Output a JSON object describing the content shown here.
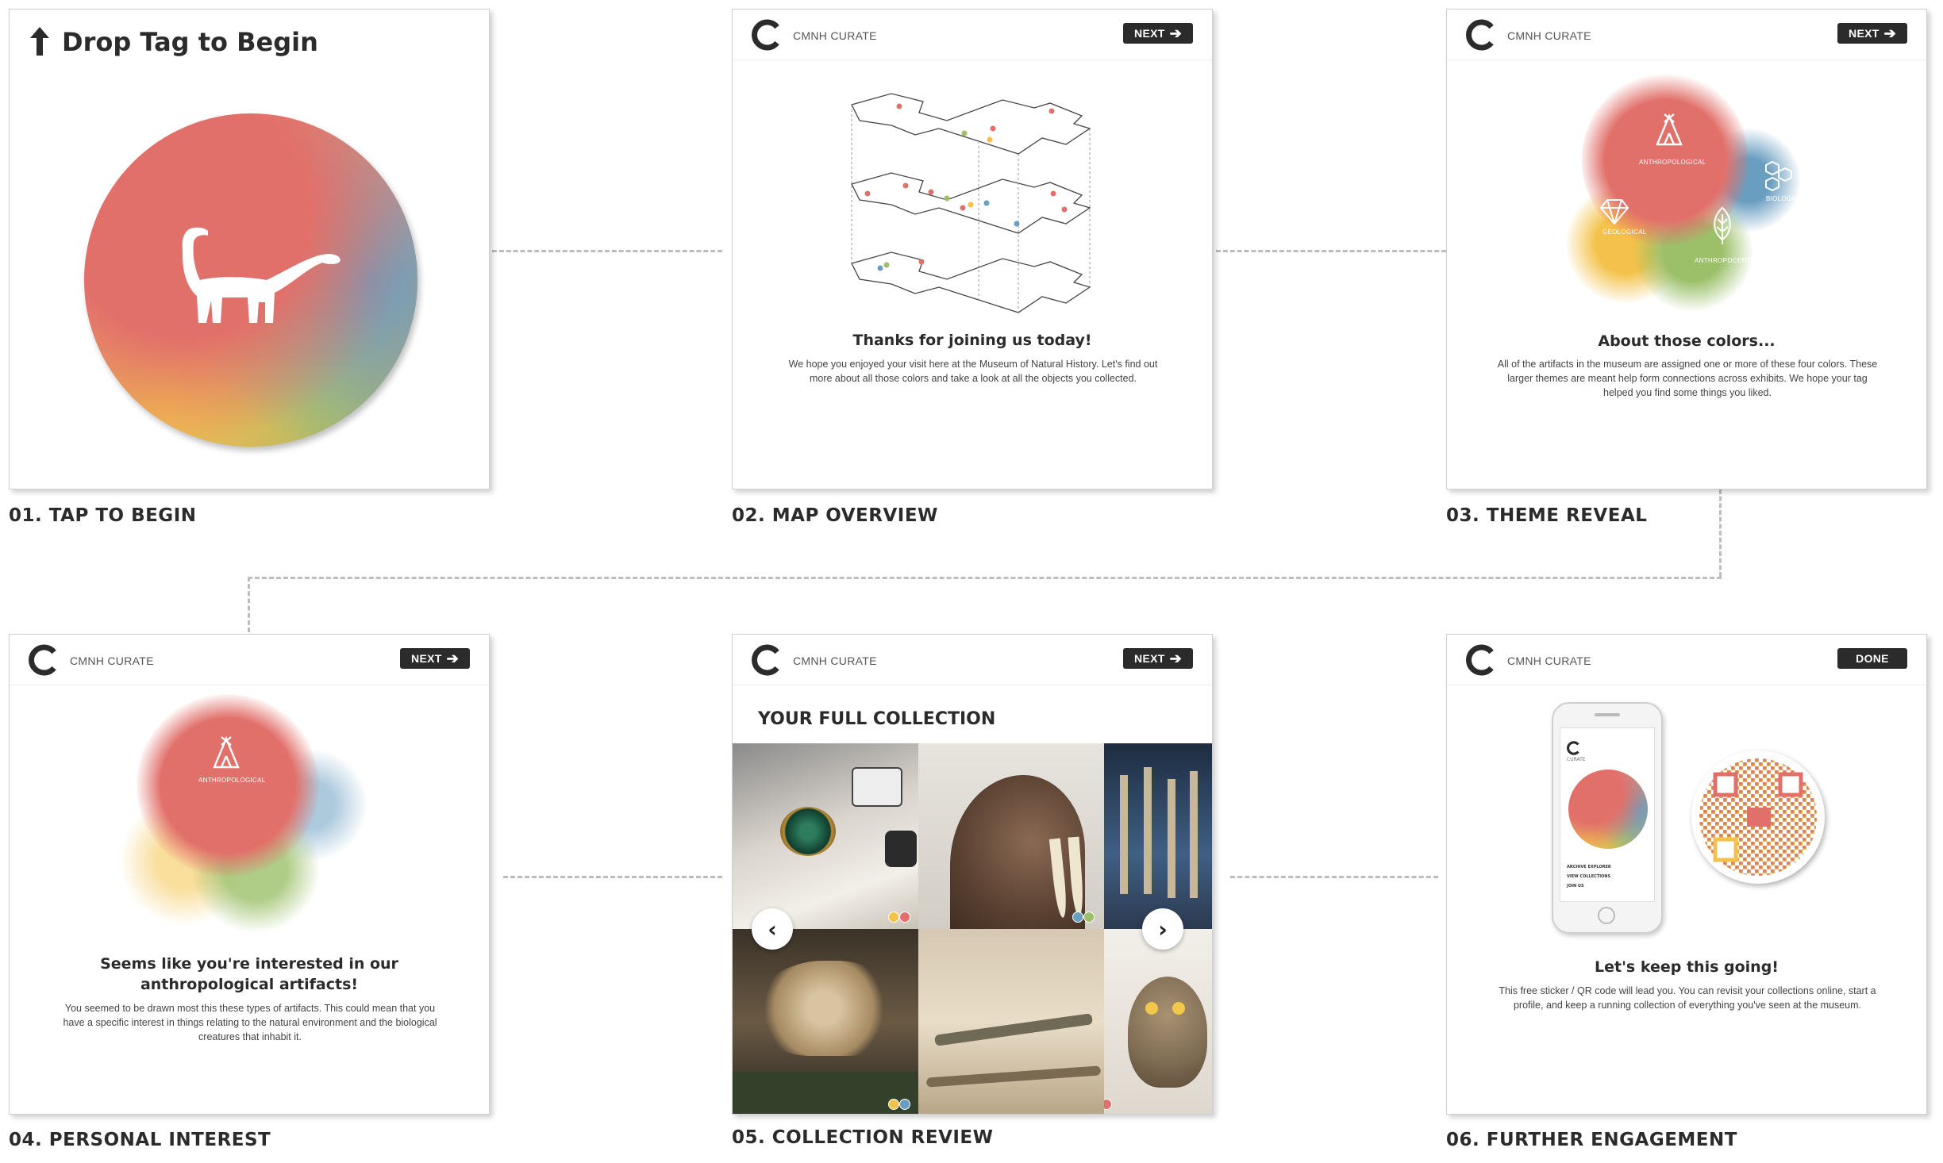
{
  "captions": [
    "01. TAP TO BEGIN",
    "02. MAP OVERVIEW",
    "03. THEME REVEAL",
    "04. PERSONAL INTEREST",
    "05. COLLECTION REVIEW",
    "06. FURTHER ENGAGEMENT"
  ],
  "brand": "CMNH CURATE",
  "next_label": "NEXT",
  "done_label": "DONE",
  "colors": {
    "red": "#e2706a",
    "blue": "#6a9ec1",
    "yellow": "#f4c24a",
    "green": "#9cc06a",
    "dark": "#2b2b2b"
  },
  "screen1": {
    "prompt": "Drop Tag to Begin"
  },
  "screen2": {
    "title": "Thanks for joining us today!",
    "body": "We hope you enjoyed your visit here at the Museum of Natural History. Let's find out more about all those colors and take a look at all the objects you collected."
  },
  "screen3": {
    "labels": {
      "anthro": "ANTHROPOLOGICAL",
      "bio": "BIOLOGICAL",
      "geo": "GEOLOGICAL",
      "anthroc": "ANTHROPOCENTRIC"
    },
    "title": "About those colors...",
    "body": "All of the artifacts in the museum are assigned one or more of these four colors. These larger themes are meant help form connections across exhibits. We hope your tag helped you find some things you liked."
  },
  "screen4": {
    "label": "ANTHROPOLOGICAL",
    "title_line1": "Seems like you're interested in our",
    "title_line2": "anthropological artifacts!",
    "body": "You seemed to be drawn most this these types of artifacts. This could mean that you have a specific interest in things relating to the natural environment and the biological creatures that inhabit it."
  },
  "screen5": {
    "title": "YOUR FULL COLLECTION"
  },
  "screen6": {
    "title": "Let's keep this going!",
    "body": "This free sticker / QR code will lead you. You can revisit your collections online, start a profile, and keep a running collection of everything you've seen at the museum.",
    "phone": {
      "brand": "CURATE",
      "links": [
        "ARCHIVE EXPLORER",
        "VIEW COLLECTIONS",
        "JOIN US"
      ]
    }
  }
}
